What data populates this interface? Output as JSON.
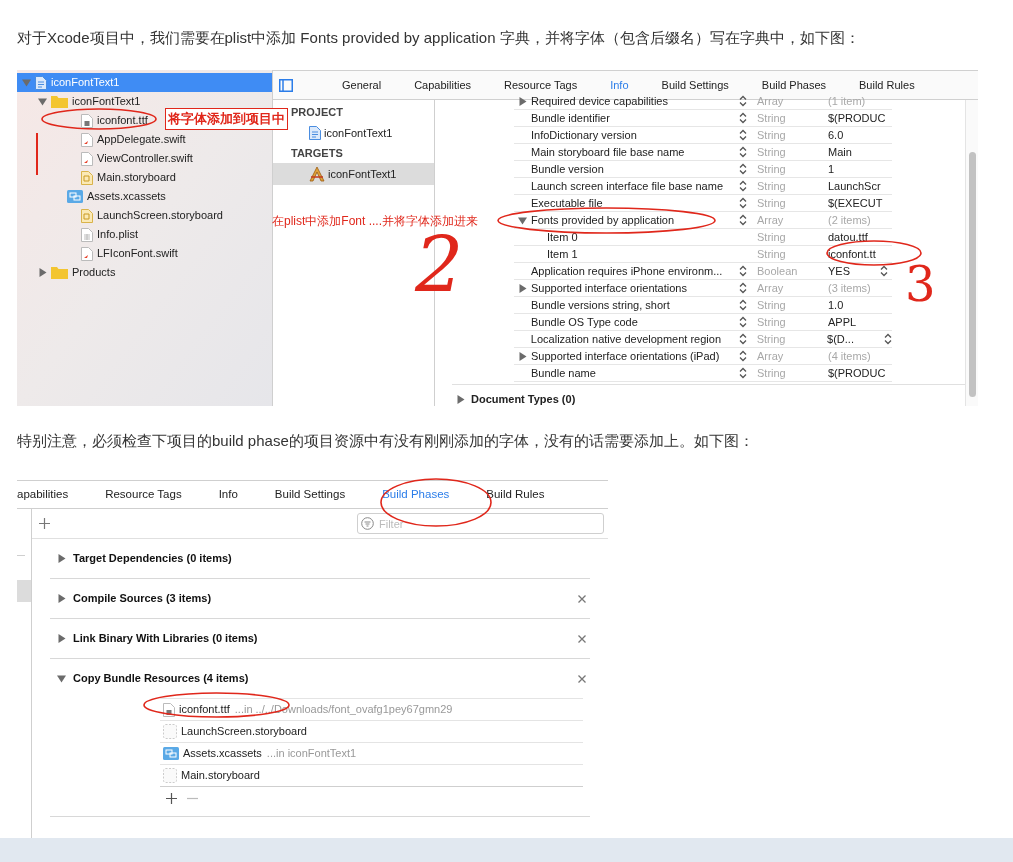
{
  "intro": "对于Xcode项目中，我们需要在plist中添加 Fonts provided by application 字典，并将字体（包含后缀名）写在字典中，如下图：",
  "figure_1": {
    "navigator": [
      {
        "name": "iconFontText1",
        "kind": "project",
        "selected": true,
        "expanded": true,
        "children": [
          {
            "name": "iconFontText1",
            "kind": "folder",
            "selected": false,
            "expanded": true,
            "children": [
              {
                "name": "iconfont.ttf",
                "kind": "font",
                "selected": false
              },
              {
                "name": "AppDelegate.swift",
                "kind": "swift",
                "selected": false
              },
              {
                "name": "ViewController.swift",
                "kind": "swift",
                "selected": false
              },
              {
                "name": "Main.storyboard",
                "kind": "storyboard",
                "selected": false
              },
              {
                "name": "Assets.xcassets",
                "kind": "assets",
                "selected": false
              },
              {
                "name": "LaunchScreen.storyboard",
                "kind": "storyboard",
                "selected": false
              },
              {
                "name": "Info.plist",
                "kind": "plist",
                "selected": false
              },
              {
                "name": "LFIconFont.swift",
                "kind": "swift",
                "selected": false
              }
            ]
          },
          {
            "name": "Products",
            "kind": "folder",
            "selected": false,
            "expanded": false
          }
        ]
      }
    ],
    "tabs": [
      {
        "label": "General",
        "selected": false
      },
      {
        "label": "Capabilities",
        "selected": false
      },
      {
        "label": "Resource Tags",
        "selected": false
      },
      {
        "label": "Info",
        "selected": true
      },
      {
        "label": "Build Settings",
        "selected": false
      },
      {
        "label": "Build Phases",
        "selected": false
      },
      {
        "label": "Build Rules",
        "selected": false
      }
    ],
    "targets_list": [
      {
        "heading": "PROJECT",
        "items": [
          {
            "label": "iconFontText1",
            "kind": "project",
            "selected": false
          }
        ]
      },
      {
        "heading": "TARGETS",
        "items": [
          {
            "label": "iconFontText1",
            "kind": "app",
            "selected": true
          }
        ]
      }
    ],
    "plist": [
      {
        "key": "Required device capabilities",
        "type": "Array",
        "value": "(1 item)",
        "kind": "array",
        "expanded": false
      },
      {
        "key": "Bundle identifier",
        "type": "String",
        "value": "$(PRODUC",
        "kind": "string"
      },
      {
        "key": "InfoDictionary version",
        "type": "String",
        "value": "6.0",
        "kind": "string"
      },
      {
        "key": "Main storyboard file base name",
        "type": "String",
        "value": "Main",
        "kind": "string"
      },
      {
        "key": "Bundle version",
        "type": "String",
        "value": "1",
        "kind": "string"
      },
      {
        "key": "Launch screen interface file base name",
        "type": "String",
        "value": "LaunchScr",
        "kind": "string"
      },
      {
        "key": "Executable file",
        "type": "String",
        "value": "$(EXECUT",
        "kind": "string"
      },
      {
        "key": "Fonts provided by application",
        "type": "Array",
        "value": "(2 items)",
        "kind": "array",
        "expanded": true,
        "children": [
          {
            "key": "Item 0",
            "type": "String",
            "value": "datou.ttf"
          },
          {
            "key": "Item 1",
            "type": "String",
            "value": "iconfont.tt"
          }
        ]
      },
      {
        "key": "Application requires iPhone environm...",
        "type": "Boolean",
        "value": "YES",
        "kind": "choice"
      },
      {
        "key": "Supported interface orientations",
        "type": "Array",
        "value": "(3 items)",
        "kind": "array",
        "expanded": false
      },
      {
        "key": "Bundle versions string, short",
        "type": "String",
        "value": "1.0",
        "kind": "string"
      },
      {
        "key": "Bundle OS Type code",
        "type": "String",
        "value": "APPL",
        "kind": "string"
      },
      {
        "key": "Localization native development region",
        "type": "String",
        "value": "$(D...",
        "kind": "choice"
      },
      {
        "key": "Supported interface orientations (iPad)",
        "type": "Array",
        "value": "(4 items)",
        "kind": "array",
        "expanded": false
      },
      {
        "key": "Bundle name",
        "type": "String",
        "value": "$(PRODUC",
        "kind": "string"
      }
    ],
    "document_types": {
      "label": "Document Types (0)",
      "expanded": false
    },
    "annotations": {
      "label_1": "将字体添加到项目中",
      "label_2": "在plist中添加Font ....并将字体添加进来",
      "mark_2": "2",
      "mark_3": "3"
    }
  },
  "note": "特别注意，必须检查下项目的build phase的项目资源中有没有刚刚添加的字体，没有的话需要添加上。如下图：",
  "figure_2": {
    "tabs": [
      {
        "label": "apabilities",
        "selected": false
      },
      {
        "label": "Resource Tags",
        "selected": false
      },
      {
        "label": "Info",
        "selected": false
      },
      {
        "label": "Build Settings",
        "selected": false
      },
      {
        "label": "Build Phases",
        "selected": true
      },
      {
        "label": "Build Rules",
        "selected": false
      }
    ],
    "filter": {
      "placeholder": "Filter"
    },
    "phases": [
      {
        "title": "Target Dependencies (0 items)",
        "expanded": false,
        "removable": false
      },
      {
        "title": "Compile Sources (3 items)",
        "expanded": false,
        "removable": true
      },
      {
        "title": "Link Binary With Libraries (0 items)",
        "expanded": false,
        "removable": true
      },
      {
        "title": "Copy Bundle Resources (4 items)",
        "expanded": true,
        "removable": true,
        "files": [
          {
            "name": "iconfont.ttf",
            "location": "...in ../../Downloads/font_ovafg1pey67gmn29",
            "kind": "font"
          },
          {
            "name": "LaunchScreen.storyboard",
            "kind": "blank"
          },
          {
            "name": "Assets.xcassets",
            "location": "...in iconFontText1",
            "kind": "assets"
          },
          {
            "name": "Main.storyboard",
            "kind": "blank"
          }
        ]
      }
    ]
  }
}
